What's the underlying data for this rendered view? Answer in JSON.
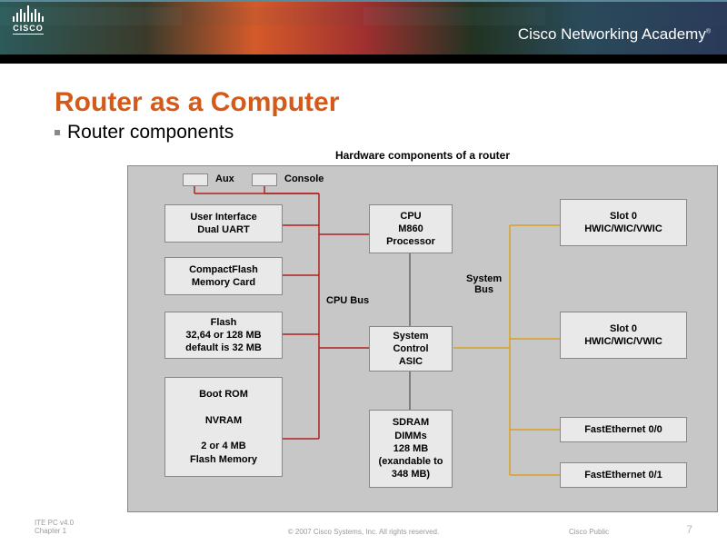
{
  "header": {
    "brand": "CISCO",
    "academy_text": "Cisco Networking Academy"
  },
  "slide": {
    "title": "Router as a Computer",
    "bullet": "Router components"
  },
  "diagram": {
    "title": "Hardware components of a router",
    "ports": {
      "aux": "Aux",
      "console": "Console"
    },
    "labels": {
      "cpu_bus": "CPU Bus",
      "system_bus": "System\nBus"
    },
    "boxes": {
      "ui": "User Interface\nDual UART",
      "cf": "CompactFlash\nMemory Card",
      "flash": "Flash\n32,64 or 128 MB\ndefault is 32 MB",
      "bootrom": "Boot ROM\n\nNVRAM\n\n2 or 4 MB\nFlash Memory",
      "cpu": "CPU\nM860\nProcessor",
      "asic": "System\nControl\nASIC",
      "sdram": "SDRAM\nDIMMs\n128 MB\n(exandable to\n348 MB)",
      "slot0a": "Slot 0\nHWIC/WIC/VWIC",
      "slot0b": "Slot 0\nHWIC/WIC/VWIC",
      "fe00": "FastEthernet 0/0",
      "fe01": "FastEthernet 0/1"
    }
  },
  "footer": {
    "left_line1": "ITE PC v4.0",
    "left_line2": "Chapter 1",
    "center": "© 2007 Cisco Systems, Inc. All rights reserved.",
    "right": "Cisco Public",
    "page": "7"
  }
}
